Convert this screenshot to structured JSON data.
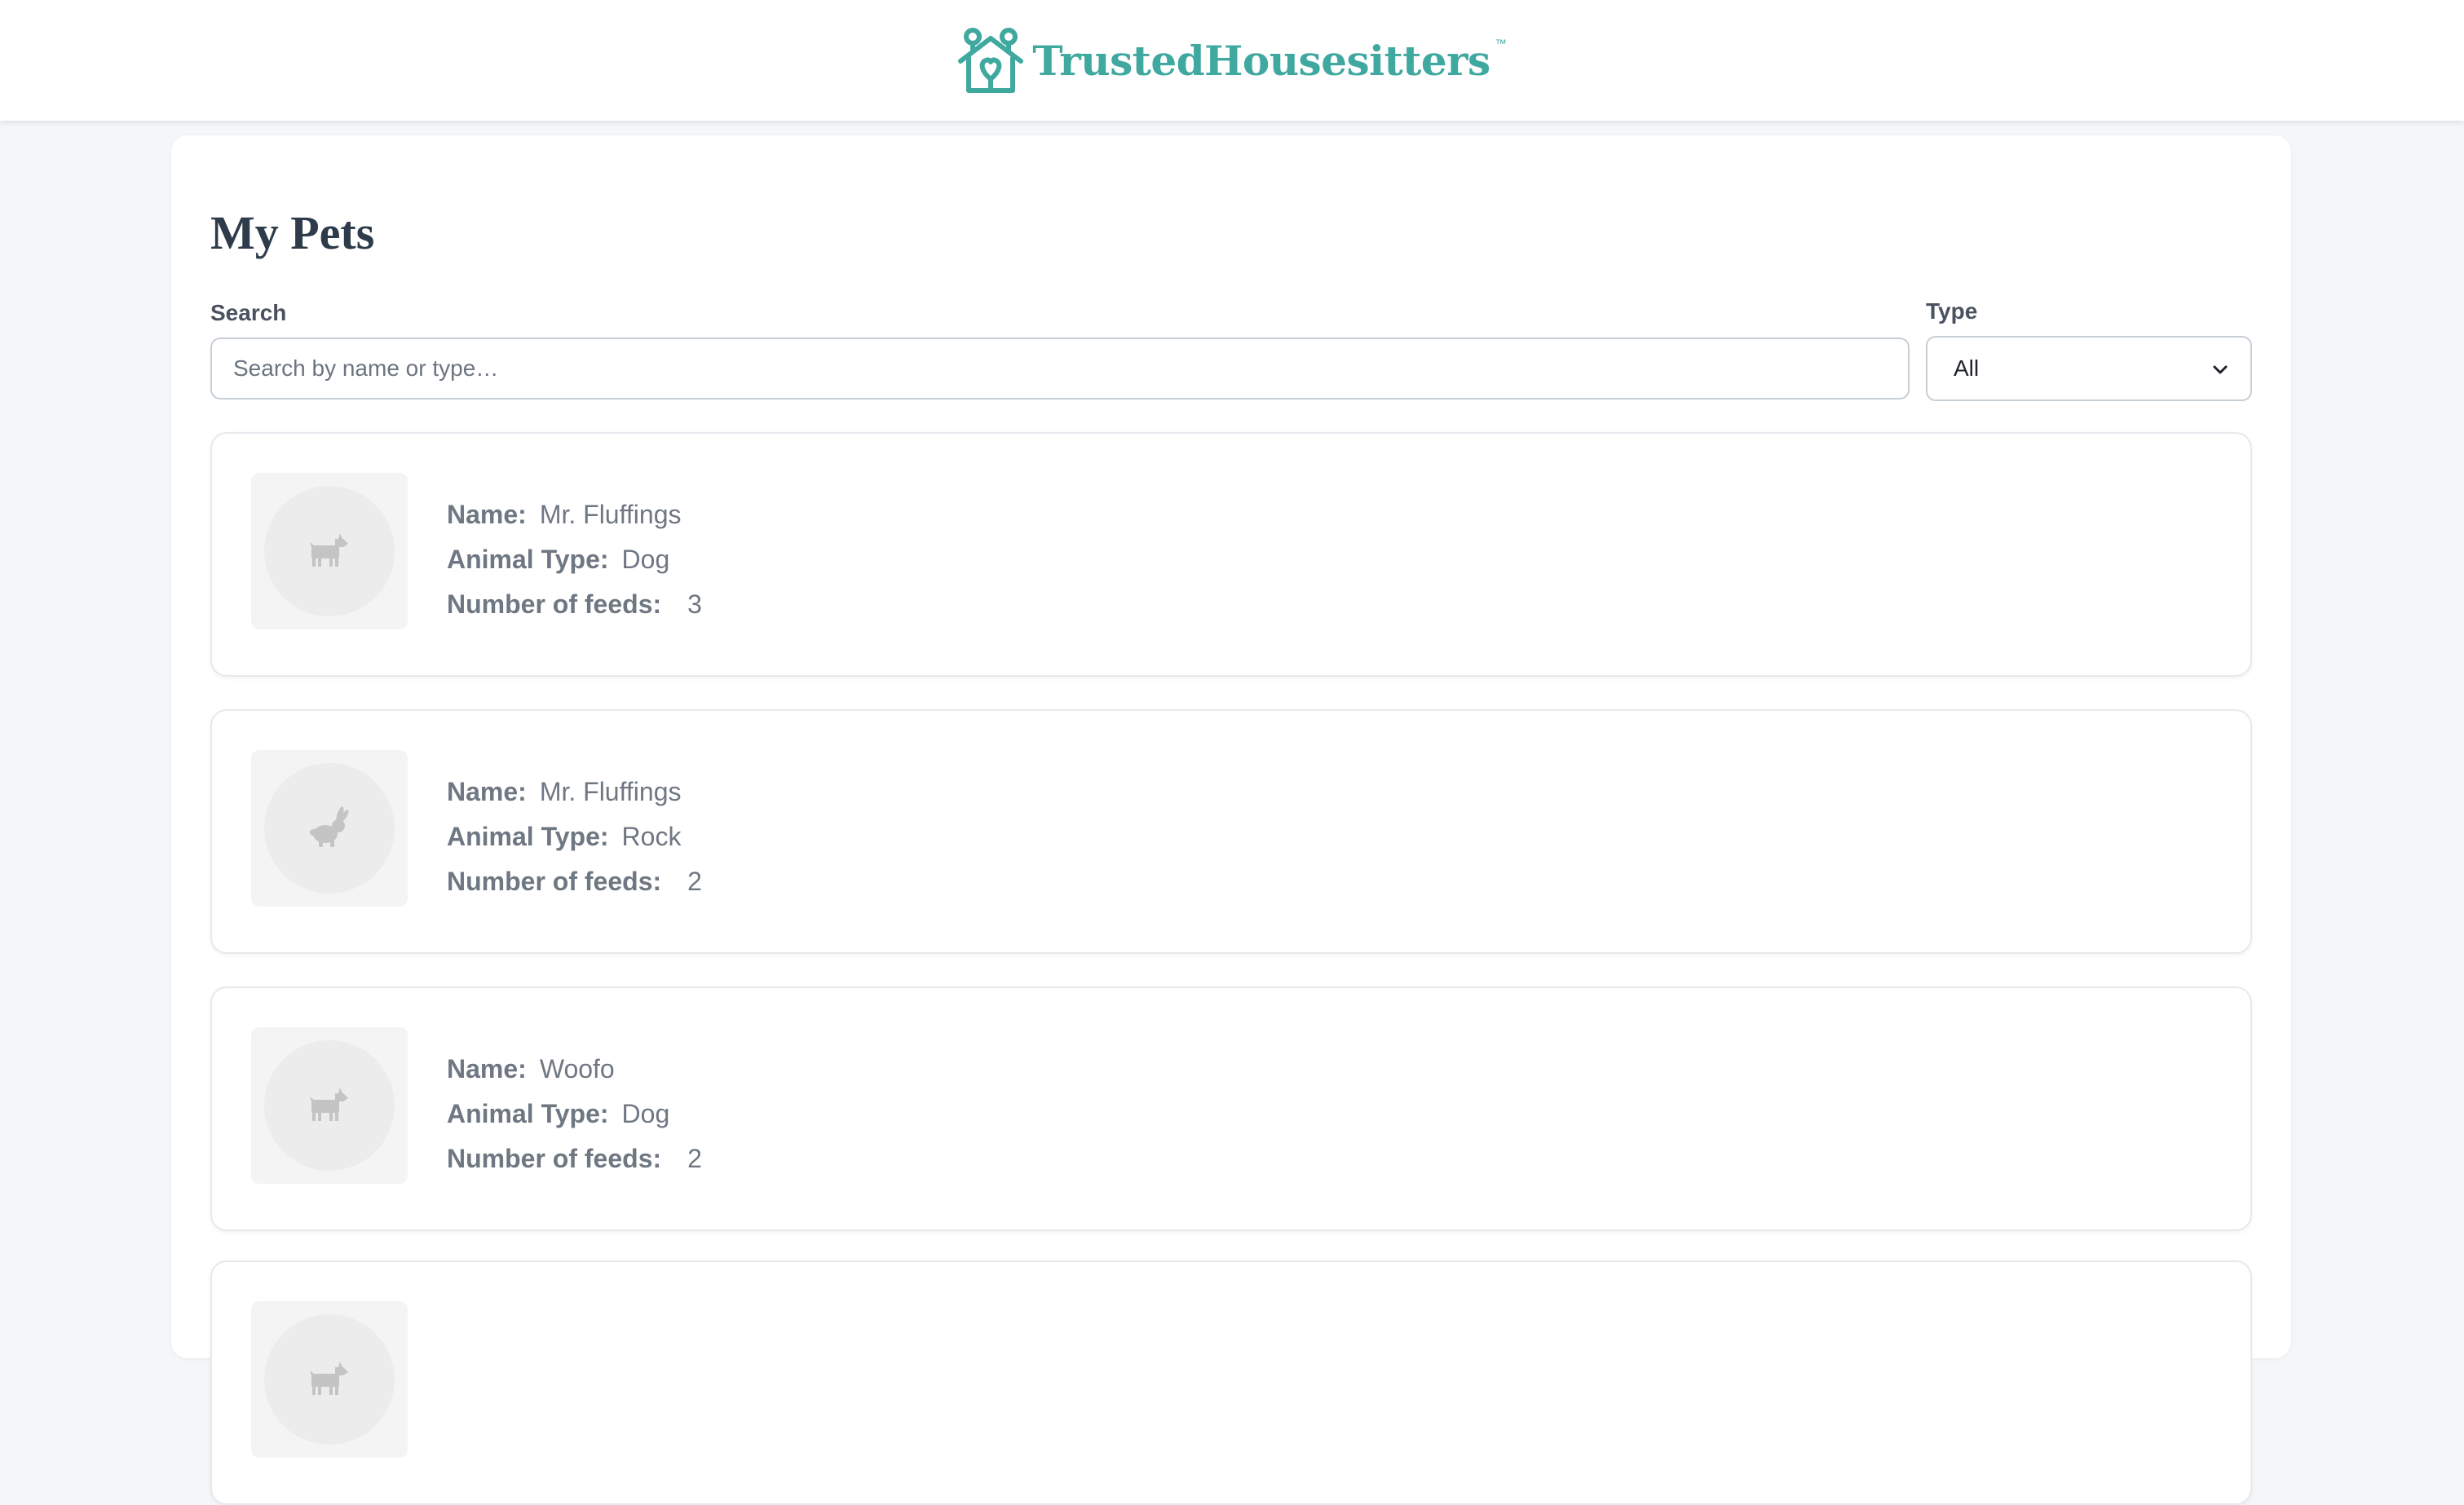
{
  "brand": {
    "name": "TrustedHousesitters",
    "trademark": "™",
    "color": "#3fa89f"
  },
  "page": {
    "title": "My Pets"
  },
  "filters": {
    "search_label": "Search",
    "search_placeholder": "Search by name or type…",
    "search_value": "",
    "type_label": "Type",
    "type_value": "All"
  },
  "field_labels": {
    "name": "Name:",
    "type": "Animal Type:",
    "feeds": "Number of feeds:"
  },
  "pets": [
    {
      "name": "Mr. Fluffings",
      "type": "Dog",
      "feeds": "3",
      "icon": "dog-icon"
    },
    {
      "name": "Mr. Fluffings",
      "type": "Rock",
      "feeds": "2",
      "icon": "rabbit-icon"
    },
    {
      "name": "Woofo",
      "type": "Dog",
      "feeds": "2",
      "icon": "dog-icon"
    },
    {
      "icon": "dog-icon"
    }
  ]
}
